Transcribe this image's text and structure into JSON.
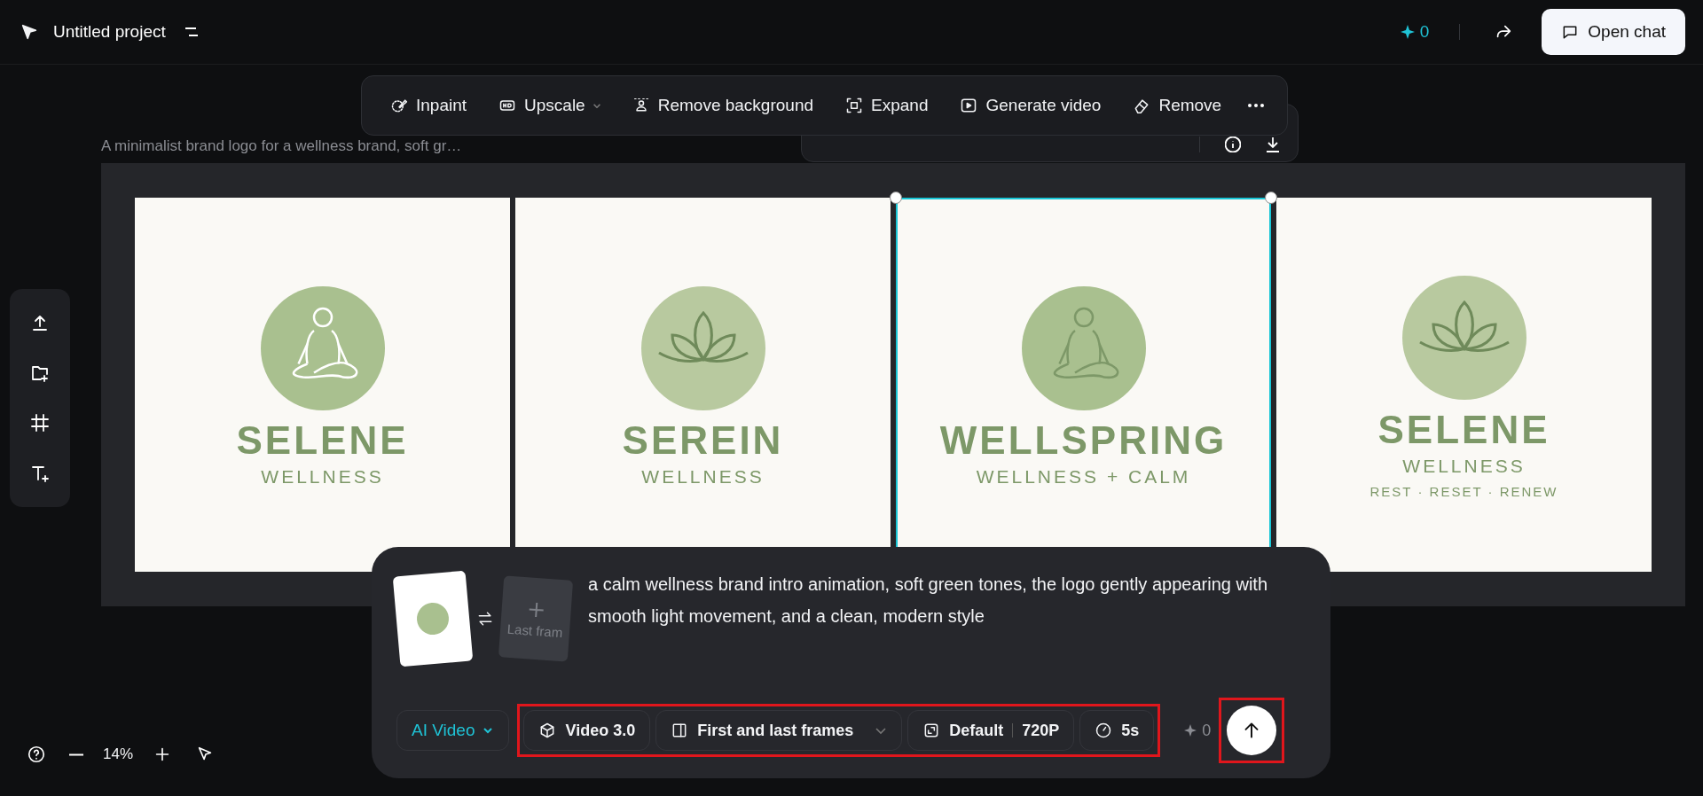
{
  "header": {
    "title": "Untitled project",
    "credits": "0",
    "open_chat": "Open chat"
  },
  "image_toolbar": {
    "items": [
      {
        "kind": "inpaint",
        "label": "Inpaint",
        "dropdown": false
      },
      {
        "kind": "upscale",
        "label": "Upscale",
        "dropdown": true
      },
      {
        "kind": "remove-bg",
        "label": "Remove background",
        "dropdown": false
      },
      {
        "kind": "expand",
        "label": "Expand",
        "dropdown": false
      },
      {
        "kind": "video",
        "label": "Generate video",
        "dropdown": false
      },
      {
        "kind": "remove",
        "label": "Remove",
        "dropdown": false
      }
    ]
  },
  "canvas": {
    "prompt": "A minimalist brand logo for a wellness brand, soft gr…",
    "images": [
      {
        "kind": "meditator",
        "brand": "SELENE",
        "subtitle": "WELLNESS",
        "selected": false
      },
      {
        "kind": "lotus",
        "brand": "SEREIN",
        "subtitle": "WELLNESS",
        "selected": false
      },
      {
        "kind": "meditator",
        "brand": "WELLSPRING",
        "subtitle": "WELLNESS + CALM",
        "selected": true
      },
      {
        "kind": "lotus",
        "brand": "SELENE",
        "subtitle": "WELLNESS",
        "tagline": "REST · RESET · RENEW",
        "selected": false
      }
    ]
  },
  "zoom": {
    "level": "14%"
  },
  "composer": {
    "last_frame": "Last fram",
    "prompt": "a calm wellness brand intro animation, soft green tones, the logo gently appearing with smooth light movement, and a clean, modern style",
    "mode": "AI Video",
    "options": [
      {
        "kind": "model",
        "label": "Video 3.0"
      },
      {
        "kind": "frames",
        "label": "First and last frames"
      },
      {
        "kind": "ratio",
        "label": "Default",
        "extra": "720P"
      },
      {
        "kind": "duration",
        "label": "5s"
      }
    ],
    "options_highlighted": true,
    "cost": "0",
    "send_highlighted": true
  }
}
